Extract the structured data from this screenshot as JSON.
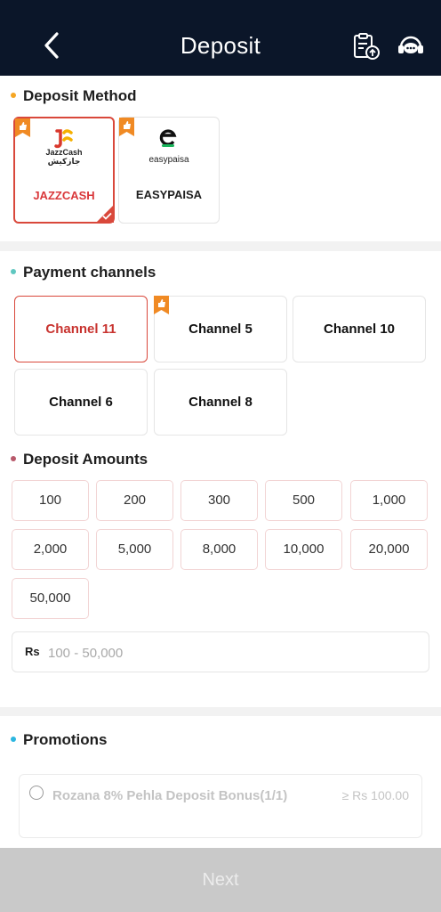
{
  "header": {
    "title": "Deposit",
    "back_icon": "chevron-left-icon",
    "record_icon": "clipboard-upload-icon",
    "support_icon": "headset-support-icon",
    "bg": "#0b1629"
  },
  "deposit_method": {
    "title": "Deposit Method",
    "dot_color": "#f5a623",
    "methods": [
      {
        "label": "JAZZCASH",
        "logo_text": "JazzCash",
        "logo_sub": "جازکیش",
        "selected": true
      },
      {
        "label": "EASYPAISA",
        "logo_text": "easypaisa",
        "selected": false
      }
    ]
  },
  "payment_channels": {
    "title": "Payment channels",
    "dot_color": "#5fc7c0",
    "channels": [
      {
        "label": "Channel 11",
        "selected": true
      },
      {
        "label": "Channel 5",
        "badge": true
      },
      {
        "label": "Channel 10"
      },
      {
        "label": "Channel 6"
      },
      {
        "label": "Channel 8"
      }
    ]
  },
  "deposit_amounts": {
    "title": "Deposit Amounts",
    "dot_color": "#b8596b",
    "amounts": [
      "100",
      "200",
      "300",
      "500",
      "1,000",
      "2,000",
      "5,000",
      "8,000",
      "10,000",
      "20,000",
      "50,000"
    ],
    "currency": "Rs",
    "input_placeholder": "100 - 50,000"
  },
  "promotions": {
    "title": "Promotions",
    "dot_color": "#2cb6e0",
    "items": [
      {
        "name": "Rozana 8% Pehla Deposit Bonus(1/1)",
        "min": "≥ Rs 100.00"
      }
    ]
  },
  "footer": {
    "next_label": "Next"
  },
  "accent_color": "#d9483b"
}
